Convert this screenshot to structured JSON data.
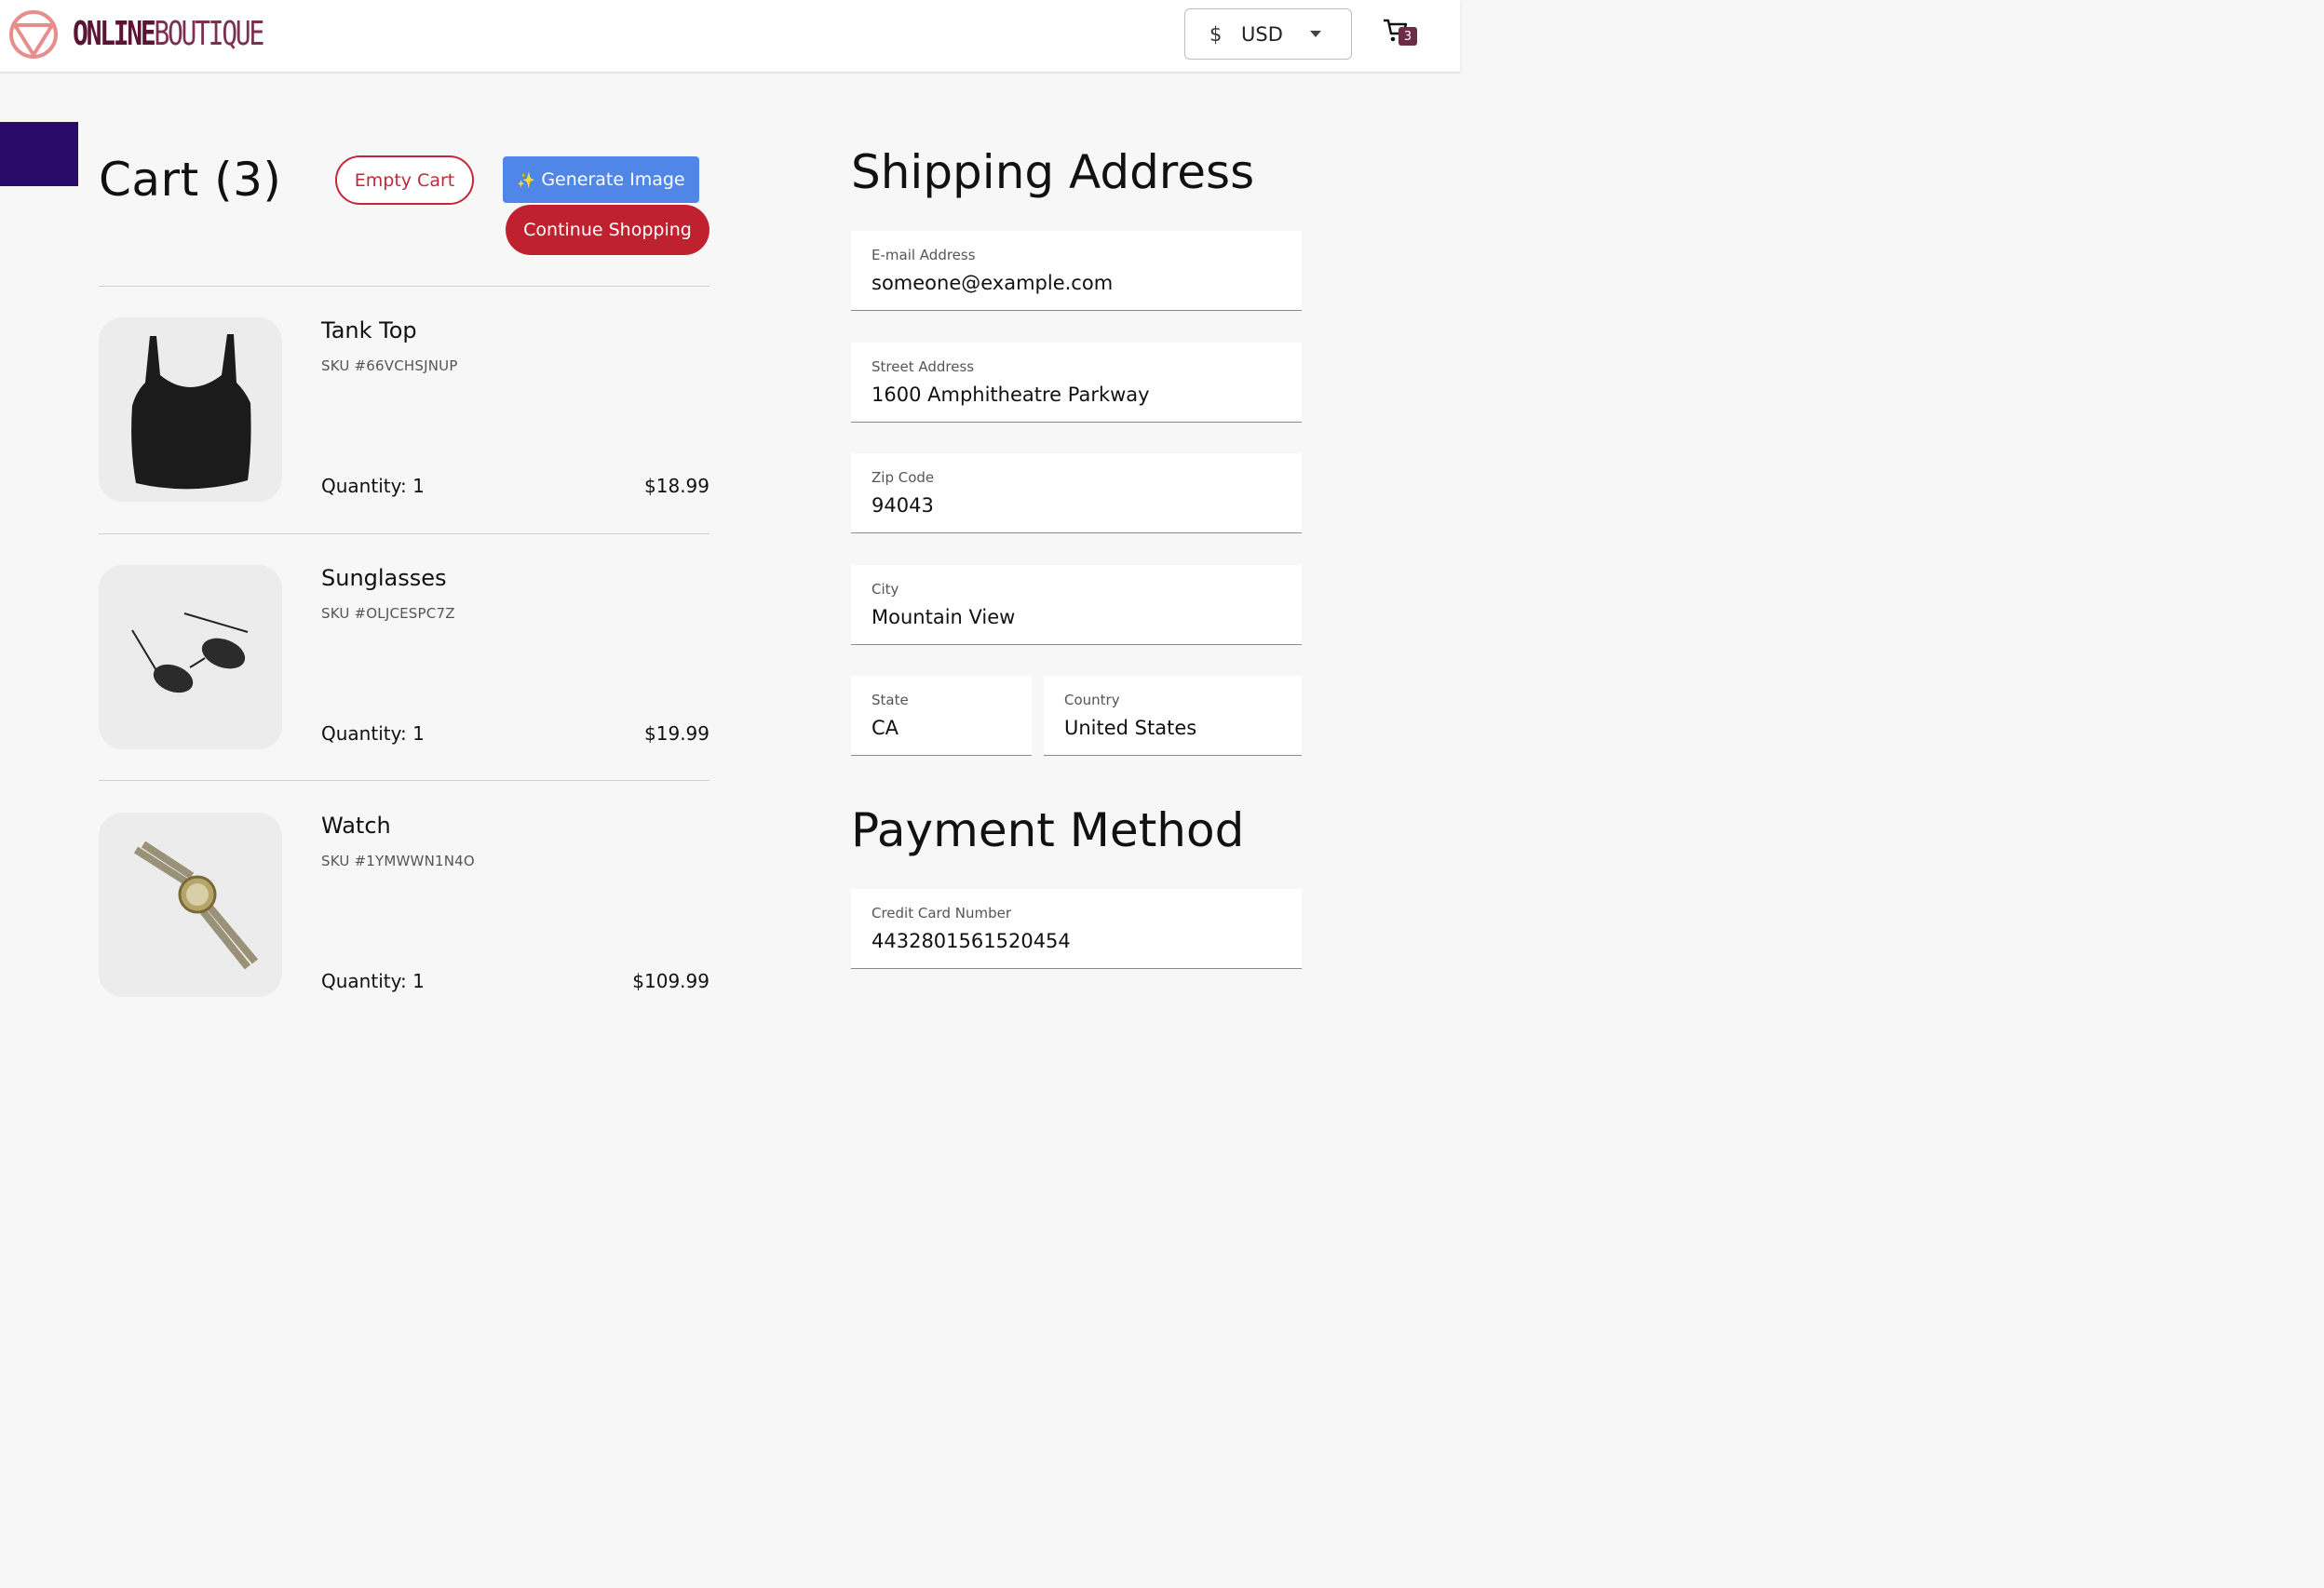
{
  "header": {
    "logo_bold": "ONLINE",
    "logo_thin": "BOUTIQUE",
    "currency_symbol": "$",
    "currency_code": "USD",
    "cart_count": "3"
  },
  "cart": {
    "title": "Cart (3)",
    "empty_label": "Empty Cart",
    "generate_label": "Generate Image",
    "continue_label": "Continue Shopping",
    "items": [
      {
        "name": "Tank Top",
        "sku": "SKU #66VCHSJNUP",
        "quantity": "Quantity: 1",
        "price": "$18.99",
        "image_icon": "tank-top-image"
      },
      {
        "name": "Sunglasses",
        "sku": "SKU #OLJCESPC7Z",
        "quantity": "Quantity: 1",
        "price": "$19.99",
        "image_icon": "sunglasses-image"
      },
      {
        "name": "Watch",
        "sku": "SKU #1YMWWN1N4O",
        "quantity": "Quantity: 1",
        "price": "$109.99",
        "image_icon": "watch-image"
      }
    ]
  },
  "shipping": {
    "title": "Shipping Address",
    "email": {
      "label": "E-mail Address",
      "value": "someone@example.com"
    },
    "street": {
      "label": "Street Address",
      "value": "1600 Amphitheatre Parkway"
    },
    "zip": {
      "label": "Zip Code",
      "value": "94043"
    },
    "city": {
      "label": "City",
      "value": "Mountain View"
    },
    "state": {
      "label": "State",
      "value": "CA"
    },
    "country": {
      "label": "Country",
      "value": "United States"
    }
  },
  "payment": {
    "title": "Payment Method",
    "card": {
      "label": "Credit Card Number",
      "value": "4432801561520454"
    }
  },
  "colors": {
    "brand": "#5a1535",
    "danger": "#c0212f",
    "primary": "#4f86e8",
    "accent_block": "#2a0a6b"
  }
}
